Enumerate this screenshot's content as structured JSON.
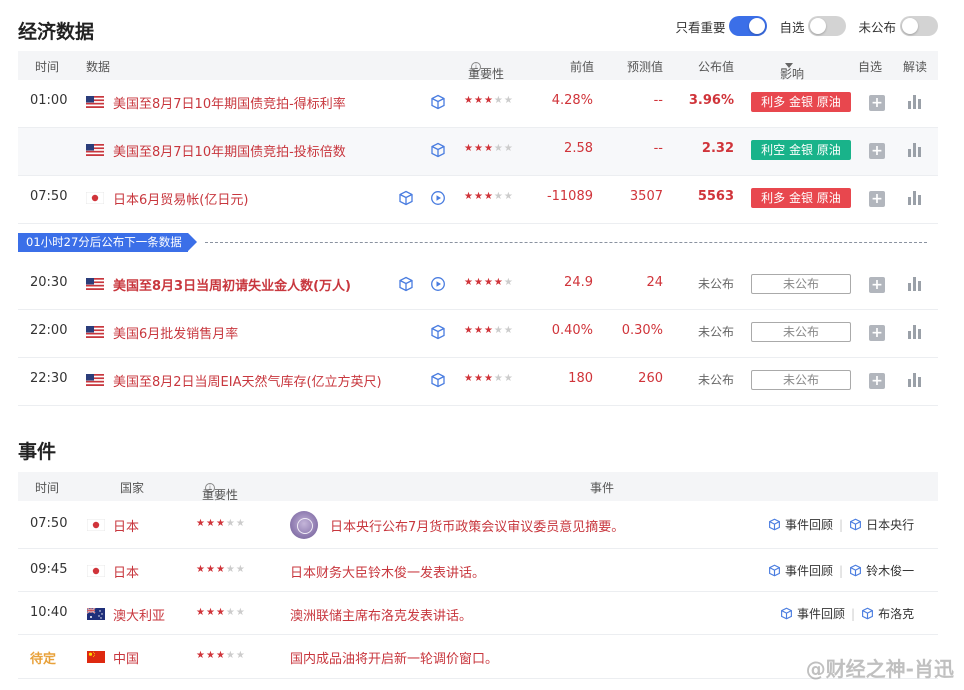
{
  "economic": {
    "title": "经济数据",
    "toggles": [
      {
        "label": "只看重要",
        "on": true
      },
      {
        "label": "自选",
        "on": false
      },
      {
        "label": "未公布",
        "on": false
      }
    ],
    "headers": {
      "time": "时间",
      "data": "数据",
      "importance": "重要性",
      "prev": "前值",
      "forecast": "预测值",
      "actual": "公布值",
      "impact": "影响",
      "watch": "自选",
      "interpret": "解读"
    },
    "rows": [
      {
        "time": "01:00",
        "country_flag": "us-flag",
        "name": "美国至8月7日10年期国债竞拍-得标利率",
        "bold": false,
        "icons": [
          "cube-icon"
        ],
        "stars": 3,
        "prev": "4.28%",
        "forecast": "--",
        "actual": "3.96%",
        "impact": "利多 金银 原油",
        "impact_color": "#e8474e"
      },
      {
        "time": "",
        "country_flag": "us-flag",
        "name": "美国至8月7日10年期国债竞拍-投标倍数",
        "bold": false,
        "icons": [
          "cube-icon"
        ],
        "stars": 3,
        "prev": "2.58",
        "forecast": "--",
        "actual": "2.32",
        "impact": "利空 金银 原油",
        "impact_color": "#19b38a"
      },
      {
        "time": "07:50",
        "country_flag": "jp-flag",
        "name": "日本6月贸易帐(亿日元)",
        "bold": false,
        "icons": [
          "cube-icon",
          "play-icon"
        ],
        "stars": 3,
        "prev": "-11089",
        "forecast": "3507",
        "actual": "5563",
        "impact": "利多 金银 原油",
        "impact_color": "#e8474e"
      },
      {
        "time": "20:30",
        "country_flag": "us-flag",
        "name": "美国至8月3日当周初请失业金人数(万人)",
        "bold": true,
        "icons": [
          "cube-icon",
          "play-icon"
        ],
        "stars": 4,
        "prev": "24.9",
        "forecast": "24",
        "actual": "未公布",
        "impact": "未公布",
        "impact_color": ""
      },
      {
        "time": "22:00",
        "country_flag": "us-flag",
        "name": "美国6月批发销售月率",
        "bold": false,
        "icons": [
          "cube-icon"
        ],
        "stars": 3,
        "prev": "0.40%",
        "forecast": "0.30%",
        "actual": "未公布",
        "impact": "未公布",
        "impact_color": ""
      },
      {
        "time": "22:30",
        "country_flag": "us-flag",
        "name": "美国至8月2日当周EIA天然气库存(亿立方英尺)",
        "bold": false,
        "icons": [
          "cube-icon"
        ],
        "stars": 3,
        "prev": "180",
        "forecast": "260",
        "actual": "未公布",
        "impact": "未公布",
        "impact_color": ""
      }
    ],
    "next_banner": "01小时27分后公布下一条数据"
  },
  "events": {
    "title": "事件",
    "headers": {
      "time": "时间",
      "country": "国家",
      "importance": "重要性",
      "event": "事件"
    },
    "rows": [
      {
        "time": "07:50",
        "pending": false,
        "country_flag": "jp-flag",
        "country": "日本",
        "stars": 3,
        "has_seal": true,
        "text": "日本央行公布7月货币政策会议审议委员意见摘要。",
        "links": [
          "事件回顾",
          "日本央行"
        ]
      },
      {
        "time": "09:45",
        "pending": false,
        "country_flag": "jp-flag",
        "country": "日本",
        "stars": 3,
        "has_seal": false,
        "text": "日本财务大臣铃木俊一发表讲话。",
        "links": [
          "事件回顾",
          "铃木俊一"
        ]
      },
      {
        "time": "10:40",
        "pending": false,
        "country_flag": "au-flag",
        "country": "澳大利亚",
        "stars": 3,
        "has_seal": false,
        "text": "澳洲联储主席布洛克发表讲话。",
        "links": [
          "事件回顾",
          "布洛克"
        ]
      },
      {
        "time": "待定",
        "pending": true,
        "country_flag": "cn-flag",
        "country": "中国",
        "stars": 3,
        "has_seal": false,
        "text": "国内成品油将开启新一轮调价窗口。",
        "links": []
      }
    ]
  },
  "watermark": "@财经之神-肖迅"
}
